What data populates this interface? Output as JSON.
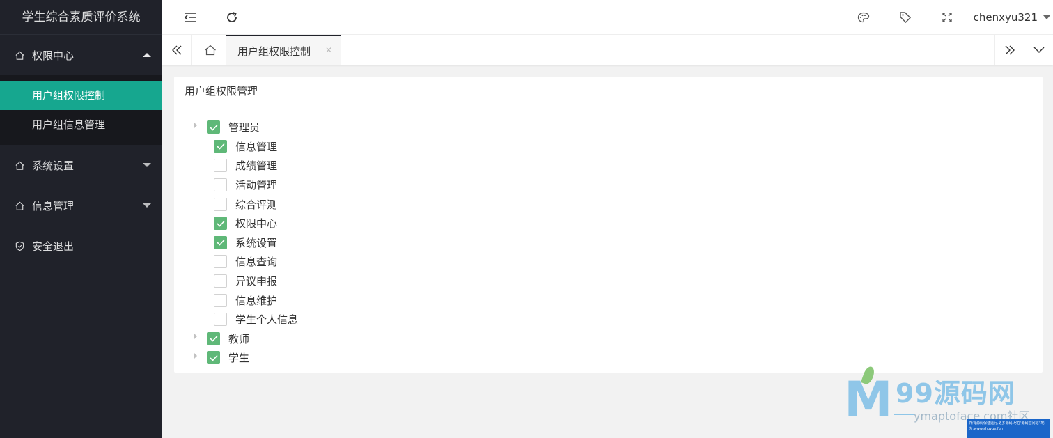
{
  "app": {
    "title": "学生综合素质评价系统"
  },
  "sidebar": {
    "menus": [
      {
        "label": "权限中心",
        "icon": "home-icon",
        "expanded": true,
        "children": [
          {
            "label": "用户组权限控制",
            "active": true
          },
          {
            "label": "用户组信息管理",
            "active": false
          }
        ]
      },
      {
        "label": "系统设置",
        "icon": "home-icon",
        "expanded": false
      },
      {
        "label": "信息管理",
        "icon": "home-icon",
        "expanded": false
      },
      {
        "label": "安全退出",
        "icon": "shield-icon"
      }
    ]
  },
  "header": {
    "user": "chenxyu321",
    "icons": [
      "menu-collapse-icon",
      "refresh-icon",
      "palette-icon",
      "tag-icon",
      "fullscreen-icon"
    ]
  },
  "tabs": {
    "active_label": "用户组权限控制"
  },
  "card": {
    "title": "用户组权限管理",
    "tree": [
      {
        "label": "管理员",
        "checked": true,
        "expandable": true,
        "children": [
          {
            "label": "信息管理",
            "checked": true
          },
          {
            "label": "成绩管理",
            "checked": false
          },
          {
            "label": "活动管理",
            "checked": false
          },
          {
            "label": "综合评测",
            "checked": false
          },
          {
            "label": "权限中心",
            "checked": true
          },
          {
            "label": "系统设置",
            "checked": true
          },
          {
            "label": "信息查询",
            "checked": false
          },
          {
            "label": "异议申报",
            "checked": false
          },
          {
            "label": "信息维护",
            "checked": false
          },
          {
            "label": "学生个人信息",
            "checked": false
          }
        ]
      },
      {
        "label": "教师",
        "checked": true,
        "expandable": true
      },
      {
        "label": "学生",
        "checked": true,
        "expandable": true
      }
    ]
  },
  "watermark": {
    "title": "99源码网",
    "url": "ymaptoface.com社区",
    "notice": "所有源码保证运行,更多源码,尽在'源码空间站',地址:www.shuyue.fun"
  },
  "colors": {
    "sidebar_bg": "#20222a",
    "active_green": "#16a78f",
    "checkbox_green": "#5fb878"
  }
}
